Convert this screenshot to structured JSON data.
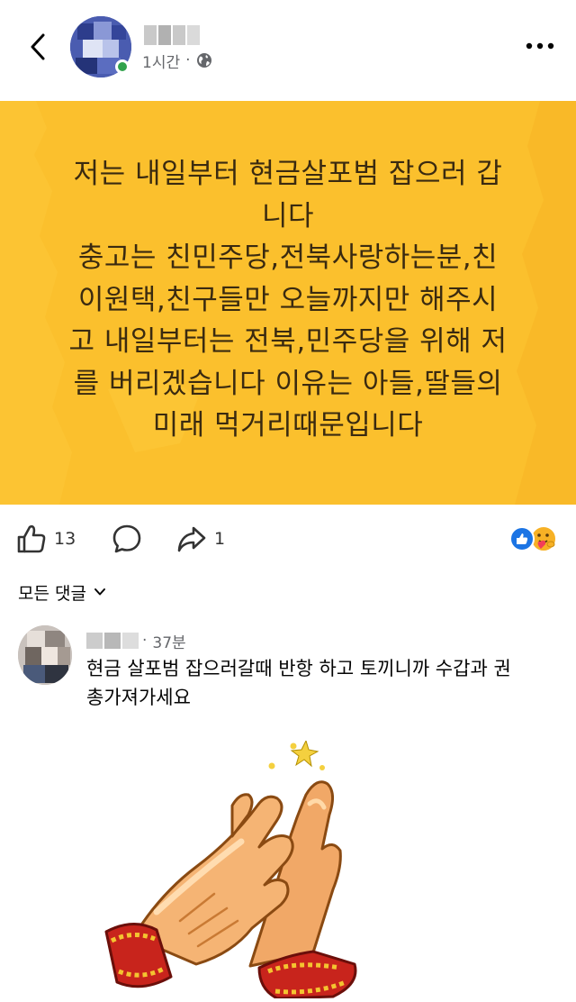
{
  "header": {
    "back_icon": "chevron-left-icon",
    "author_name_redacted": "(name blurred)",
    "time": "1시간",
    "separator": "·",
    "privacy_icon": "globe-icon",
    "more_icon": "more-dots-icon"
  },
  "post": {
    "text": "저는 내일부터 현금살포범 잡으러 갑\n니다\n충고는 친민주당,전북사랑하는분,친\n이원택,친구들만 오늘까지만 해주시\n고 내일부터는 전북,민주당을 위해 저\n를 버리겠습니다 이유는 아들,딸들의\n미래 먹거리때문입니다",
    "background_color": "#fbc02d"
  },
  "actions": {
    "like_count": "13",
    "share_count": "1",
    "like_icon": "thumbs-up-icon",
    "comment_icon": "comment-bubble-icon",
    "share_icon": "share-arrow-icon",
    "reaction_icons": [
      "like-reaction-icon",
      "care-reaction-icon"
    ]
  },
  "comments": {
    "filter_label": "모든 댓글",
    "items": [
      {
        "author_redacted": "(name blurred)",
        "time": "37분",
        "separator": "·",
        "text": "현금 살포범 잡으러갈때 반항 하고 토끼니까 수갑과 권\n총가져가세요",
        "sticker": "clapping-hands-sticker"
      }
    ]
  },
  "colors": {
    "accent_blue": "#1b74e4",
    "meta_gray": "#65676b",
    "online_green": "#31a24c"
  }
}
